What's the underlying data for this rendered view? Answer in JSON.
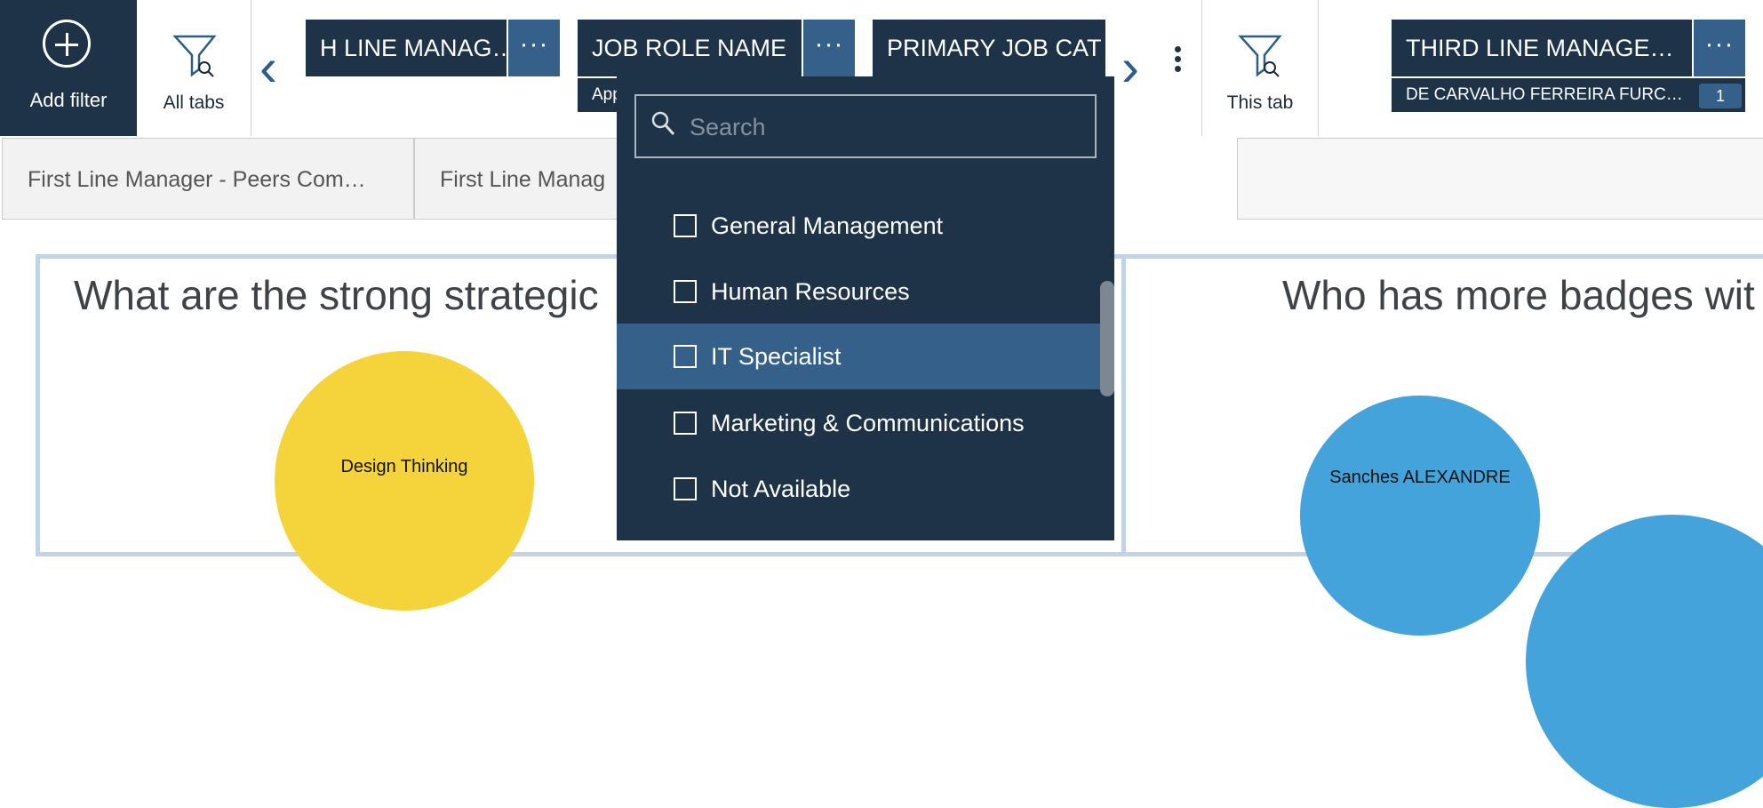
{
  "toolbar": {
    "add_filter": "Add filter",
    "all_tabs": "All tabs",
    "this_tab": "This tab"
  },
  "filters": [
    {
      "label": "H LINE MANAG…",
      "more": "···"
    },
    {
      "label": "JOB ROLE NAME",
      "more": "···",
      "sub": "App"
    },
    {
      "label": "PRIMARY JOB CAT",
      "more": ""
    },
    {
      "label": "THIRD LINE MANAGE…",
      "more": "···",
      "sub": "DE CARVALHO FERREIRA FURC…",
      "count": "1"
    }
  ],
  "tabs": [
    "First Line Manager - Peers Com…",
    "First Line Manag"
  ],
  "panels": [
    {
      "title": "What are the strong strategic",
      "bubble": "Design Thinking",
      "bubble_color": "#f5d33a"
    },
    {
      "title": "Who has more badges wit",
      "bubble": "Sanches ALEXANDRE",
      "bubble_color": "#45a3db"
    }
  ],
  "dropdown": {
    "search_placeholder": "Search",
    "options": [
      {
        "label": "General Management",
        "checked": false
      },
      {
        "label": "Human Resources",
        "checked": false
      },
      {
        "label": "IT Specialist",
        "checked": false,
        "highlighted": true
      },
      {
        "label": "Marketing & Communications",
        "checked": false
      },
      {
        "label": "Not Available",
        "checked": false
      }
    ]
  },
  "colors": {
    "navy": "#1e3348",
    "accent": "#346089",
    "arrow": "#2f5d8a"
  }
}
